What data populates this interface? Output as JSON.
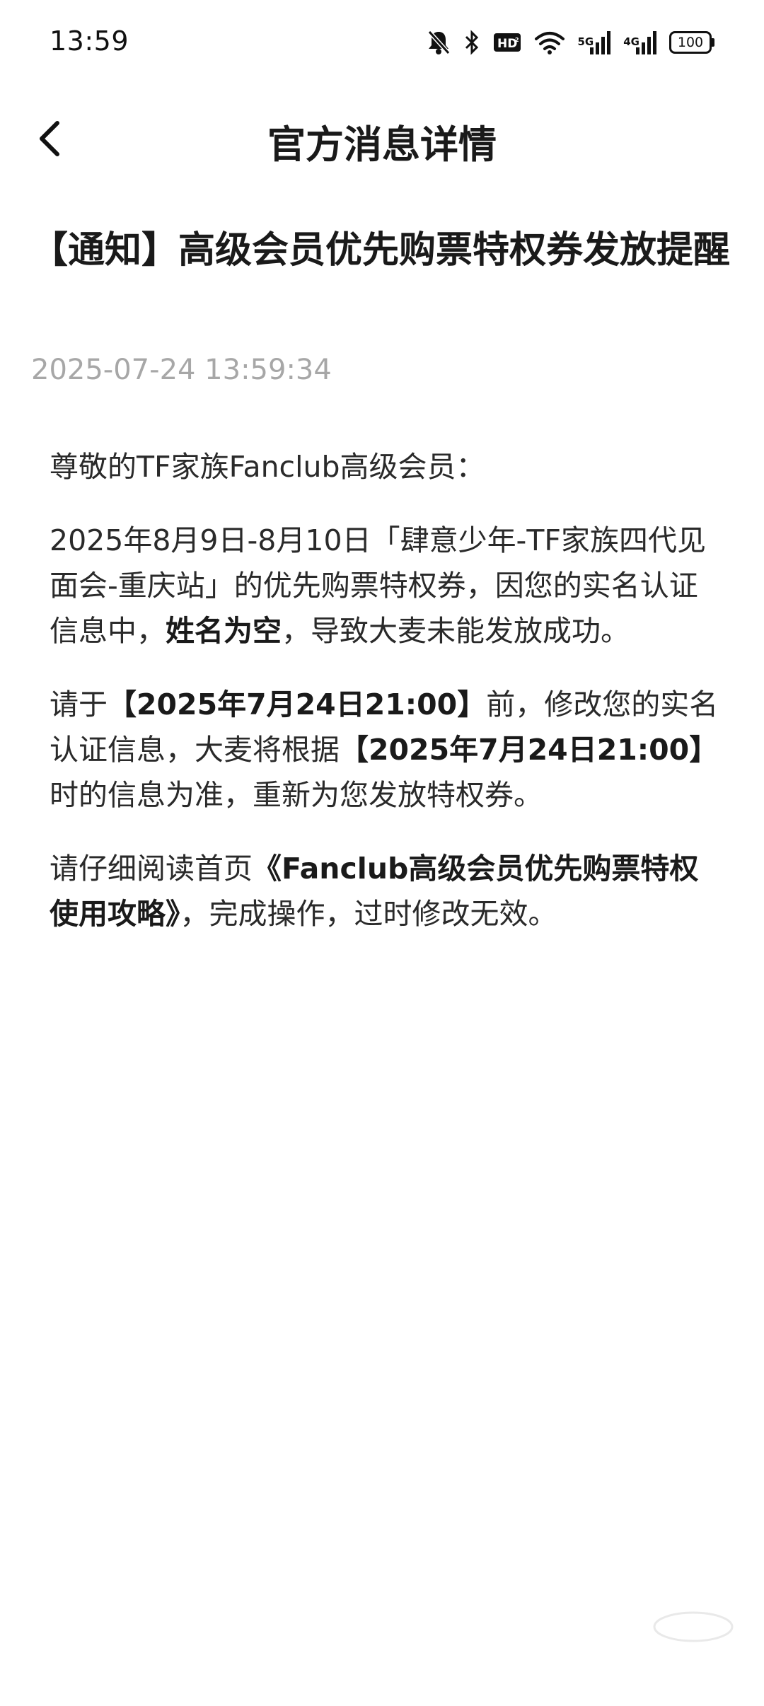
{
  "status_bar": {
    "time": "13:59",
    "network_5g": "5G",
    "network_4g": "4G",
    "battery": "100",
    "icons": [
      "mute-bell-icon",
      "bluetooth-icon",
      "hd-icon",
      "wifi-icon",
      "signal-icon",
      "signal-icon",
      "battery-icon"
    ]
  },
  "nav": {
    "back_icon": "chevron-left-icon",
    "title": "官方消息详情"
  },
  "message": {
    "title": "【通知】高级会员优先购票特权券发放提醒",
    "datetime": "2025-07-24 13:59:34",
    "greeting": "尊敬的TF家族Fanclub高级会员：",
    "p1_a": "2025年8月9日-8月10日「肆意少年-TF家族四代见面会-重庆站」的优先购票特权券，因您的实名认证信息中，",
    "p1_bold": "姓名为空",
    "p1_b": "，导致大麦未能发放成功。",
    "p2_a": "请于",
    "p2_bold1": "【2025年7月24日21:00】",
    "p2_b": "前，修改您的实名认证信息，大麦将根据",
    "p2_bold2": "【2025年7月24日21:00】",
    "p2_c": "时的信息为准，重新为您发放特权券。",
    "p3_a": "请仔细阅读首页",
    "p3_bold": "《Fanclub高级会员优先购票特权使用攻略》",
    "p3_b": "，完成操作，过时修改无效。"
  }
}
